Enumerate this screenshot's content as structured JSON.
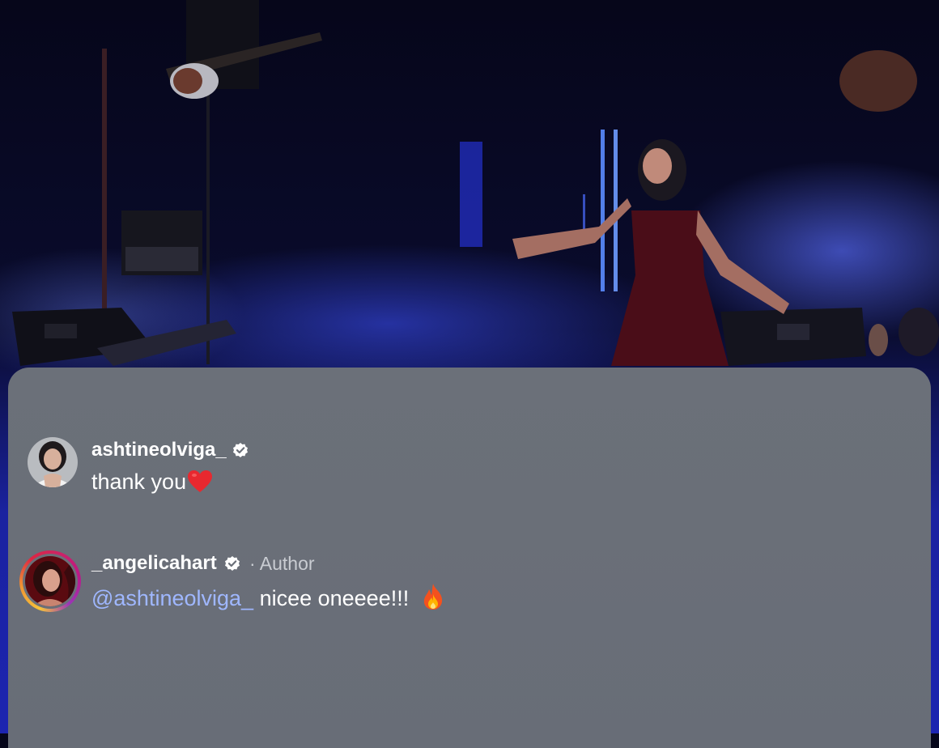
{
  "comments": [
    {
      "username": "ashtineolviga_",
      "verified": true,
      "text": "thank you",
      "emoji": "heart"
    },
    {
      "username": "_angelicahart",
      "verified": true,
      "role_label": "· Author",
      "mention": "@ashtineolviga_",
      "text": "nicee oneeee!!!",
      "emoji": "fire"
    }
  ],
  "colors": {
    "sheet_background": "#6a6f78",
    "mention": "#9fb7ff",
    "meta_text": "#c9ccd2",
    "stage_blue": "#1c24b0"
  }
}
